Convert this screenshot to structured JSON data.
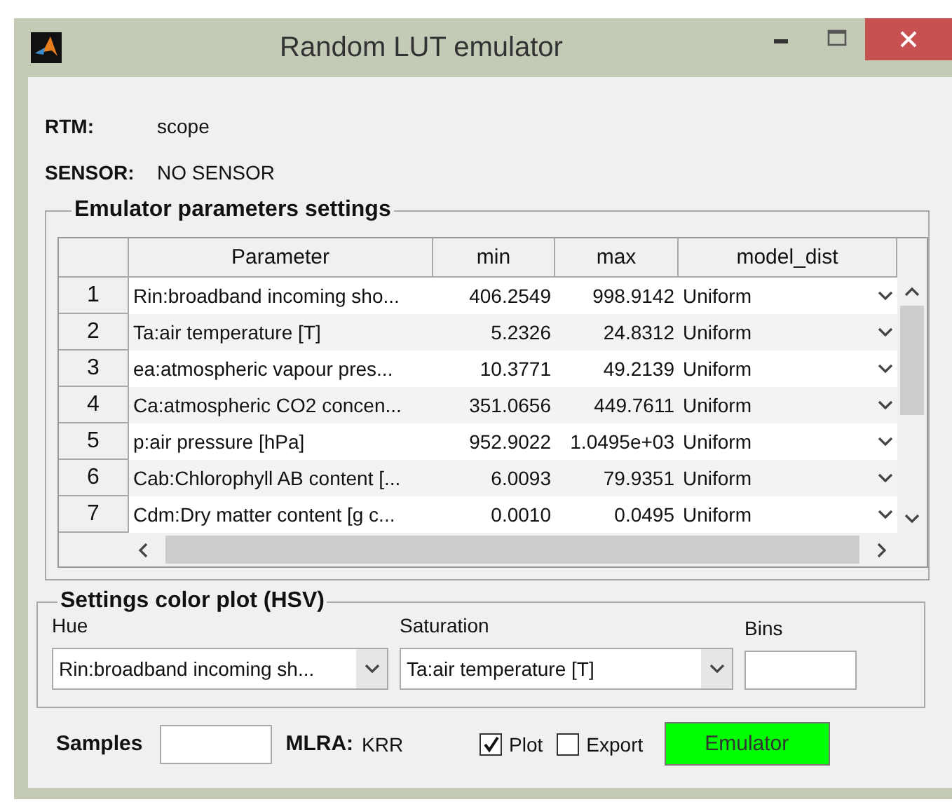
{
  "window": {
    "title": "Random LUT emulator"
  },
  "info": [
    {
      "label": "RTM:",
      "value": "scope"
    },
    {
      "label": "SENSOR:",
      "value": "NO SENSOR"
    }
  ],
  "emulator_panel": {
    "title": "Emulator parameters settings",
    "table": {
      "columns": [
        "Parameter",
        "min",
        "max",
        "model_dist"
      ],
      "rows": [
        {
          "index": "1",
          "parameter": "Rin:broadband incoming sho...",
          "min": "406.2549",
          "max": "998.9142",
          "model_dist": "Uniform"
        },
        {
          "index": "2",
          "parameter": "Ta:air temperature [T]",
          "min": "5.2326",
          "max": "24.8312",
          "model_dist": "Uniform"
        },
        {
          "index": "3",
          "parameter": "ea:atmospheric vapour pres...",
          "min": "10.3771",
          "max": "49.2139",
          "model_dist": "Uniform"
        },
        {
          "index": "4",
          "parameter": "Ca:atmospheric CO2 concen...",
          "min": "351.0656",
          "max": "449.7611",
          "model_dist": "Uniform"
        },
        {
          "index": "5",
          "parameter": "p:air pressure [hPa]",
          "min": "952.9022",
          "max": "1.0495e+03",
          "model_dist": "Uniform"
        },
        {
          "index": "6",
          "parameter": "Cab:Chlorophyll AB content [...",
          "min": "6.0093",
          "max": "79.9351",
          "model_dist": "Uniform"
        },
        {
          "index": "7",
          "parameter": "Cdm:Dry matter content [g c...",
          "min": "0.0010",
          "max": "0.0495",
          "model_dist": "Uniform"
        }
      ]
    }
  },
  "color_panel": {
    "title": "Settings color plot (HSV)",
    "hue": {
      "label": "Hue",
      "value": "Rin:broadband incoming sh..."
    },
    "saturation": {
      "label": "Saturation",
      "value": "Ta:air temperature [T]"
    },
    "bins": {
      "label": "Bins"
    }
  },
  "bottom": {
    "samples_label": "Samples",
    "mlra_label": "MLRA:",
    "mlra_value": "KRR",
    "checkboxes": [
      {
        "label": "Plot",
        "checked": true
      },
      {
        "label": "Export",
        "checked": false
      }
    ],
    "button": "Emulator"
  }
}
